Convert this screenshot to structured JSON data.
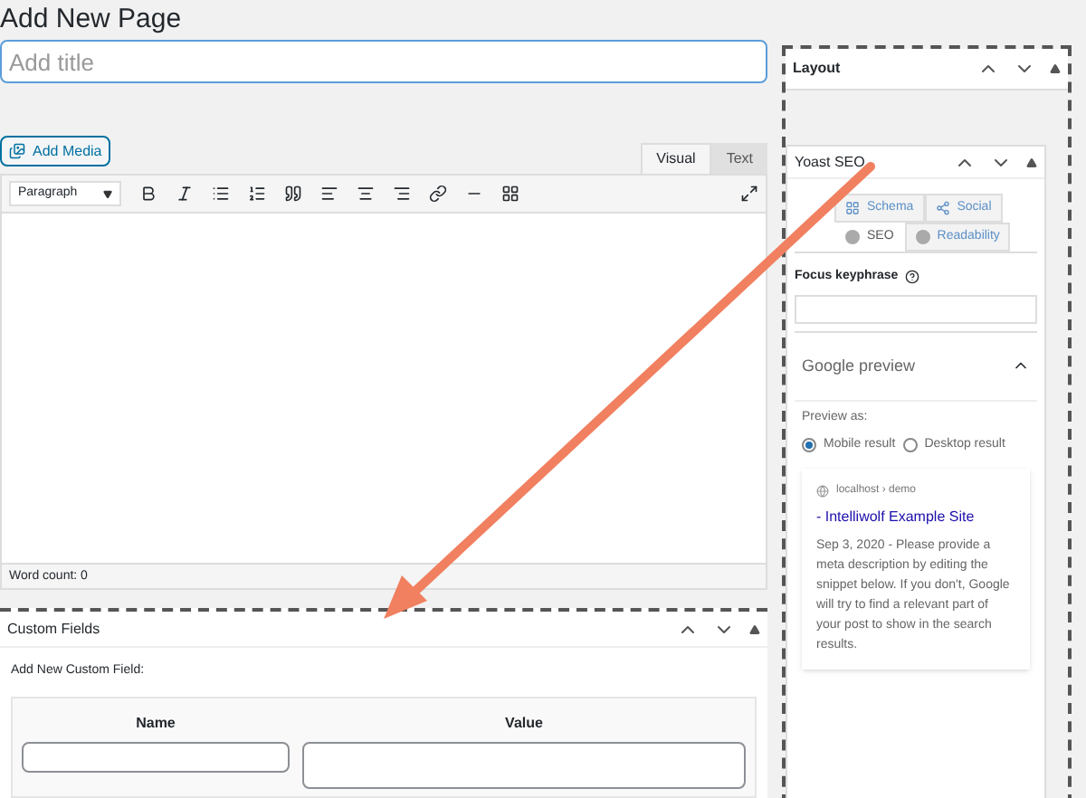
{
  "heading": "Add New Page",
  "title_field": {
    "placeholder": "Add title"
  },
  "add_media": "Add Media",
  "editor_tabs": [
    {
      "label": "Visual",
      "selected": true
    },
    {
      "label": "Text",
      "selected": false
    }
  ],
  "format_select": "Paragraph",
  "word_count": "Word count: 0",
  "custom_fields": {
    "title": "Custom Fields",
    "subtitle": "Add New Custom Field:",
    "columns": [
      "Name",
      "Value"
    ]
  },
  "layout_box": {
    "title": "Layout"
  },
  "yoast": {
    "title": "Yoast SEO",
    "tabs": [
      {
        "label": "Schema",
        "kind": "schema",
        "selected": false
      },
      {
        "label": "Social",
        "kind": "social",
        "selected": false
      },
      {
        "label": "SEO",
        "kind": "dot",
        "selected": true
      },
      {
        "label": "Readability",
        "kind": "dot",
        "selected": false
      }
    ],
    "focus_keyphrase": "Focus keyphrase",
    "google_preview": {
      "title": "Google preview",
      "preview_as": "Preview as:",
      "options": [
        {
          "label": "Mobile result",
          "selected": true
        },
        {
          "label": "Desktop result",
          "selected": false
        }
      ],
      "snippet": {
        "site": "localhost › demo",
        "title": "- Intelliwolf Example Site",
        "description": "Sep 3, 2020 - Please provide a meta description by editing the snippet below. If you don't, Google will try to find a relevant part of your post to show in the search results."
      }
    }
  }
}
